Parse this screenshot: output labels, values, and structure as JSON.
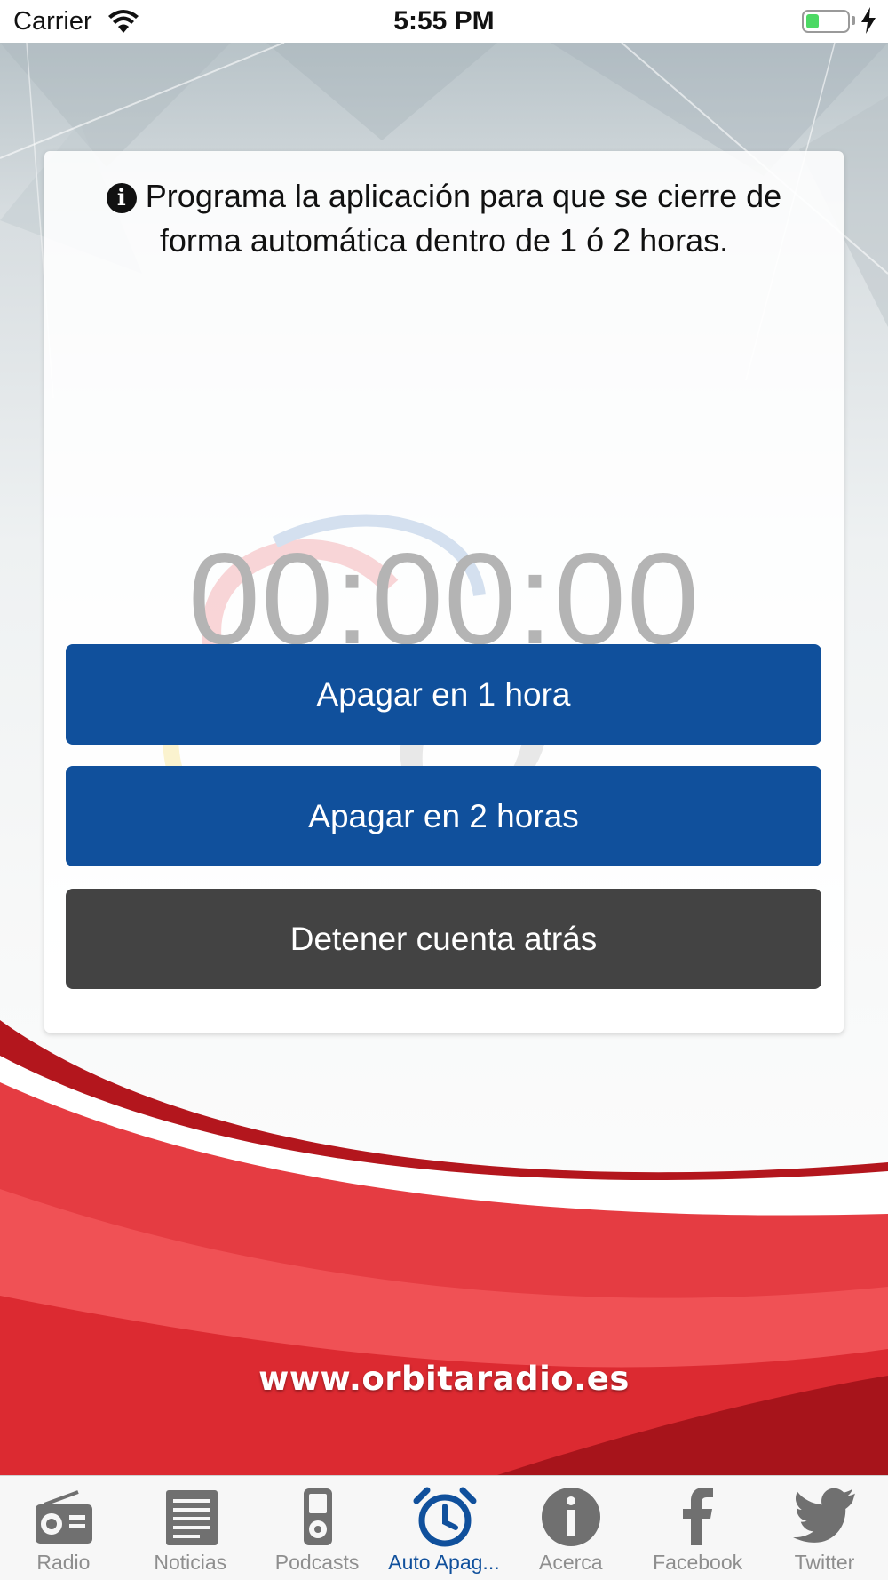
{
  "status_bar": {
    "carrier": "Carrier",
    "time": "5:55 PM",
    "battery_level": 0.3
  },
  "card": {
    "info_icon": "info-circle-icon",
    "info_text": "Programa la aplicación para que se cierre de forma automática dentro de 1 ó 2 horas.",
    "timer": "00:00:00",
    "buttons": {
      "one_hour": "Apagar en 1 hora",
      "two_hours": "Apagar en 2 horas",
      "stop": "Detener cuenta atrás"
    }
  },
  "footer": {
    "website": "www.orbitaradio.es"
  },
  "tabs": [
    {
      "label": "Radio",
      "icon": "radio-icon"
    },
    {
      "label": "Noticias",
      "icon": "newspaper-icon"
    },
    {
      "label": "Podcasts",
      "icon": "ipod-icon"
    },
    {
      "label": "Auto Apag...",
      "icon": "alarm-clock-icon",
      "active": true
    },
    {
      "label": "Acerca",
      "icon": "info-icon"
    },
    {
      "label": "Facebook",
      "icon": "facebook-icon"
    },
    {
      "label": "Twitter",
      "icon": "twitter-icon"
    }
  ],
  "colors": {
    "primary_blue": "#10509c",
    "dark_button": "#434343",
    "brand_red": "#e8383f",
    "inactive_tab": "#8e8e8e"
  }
}
